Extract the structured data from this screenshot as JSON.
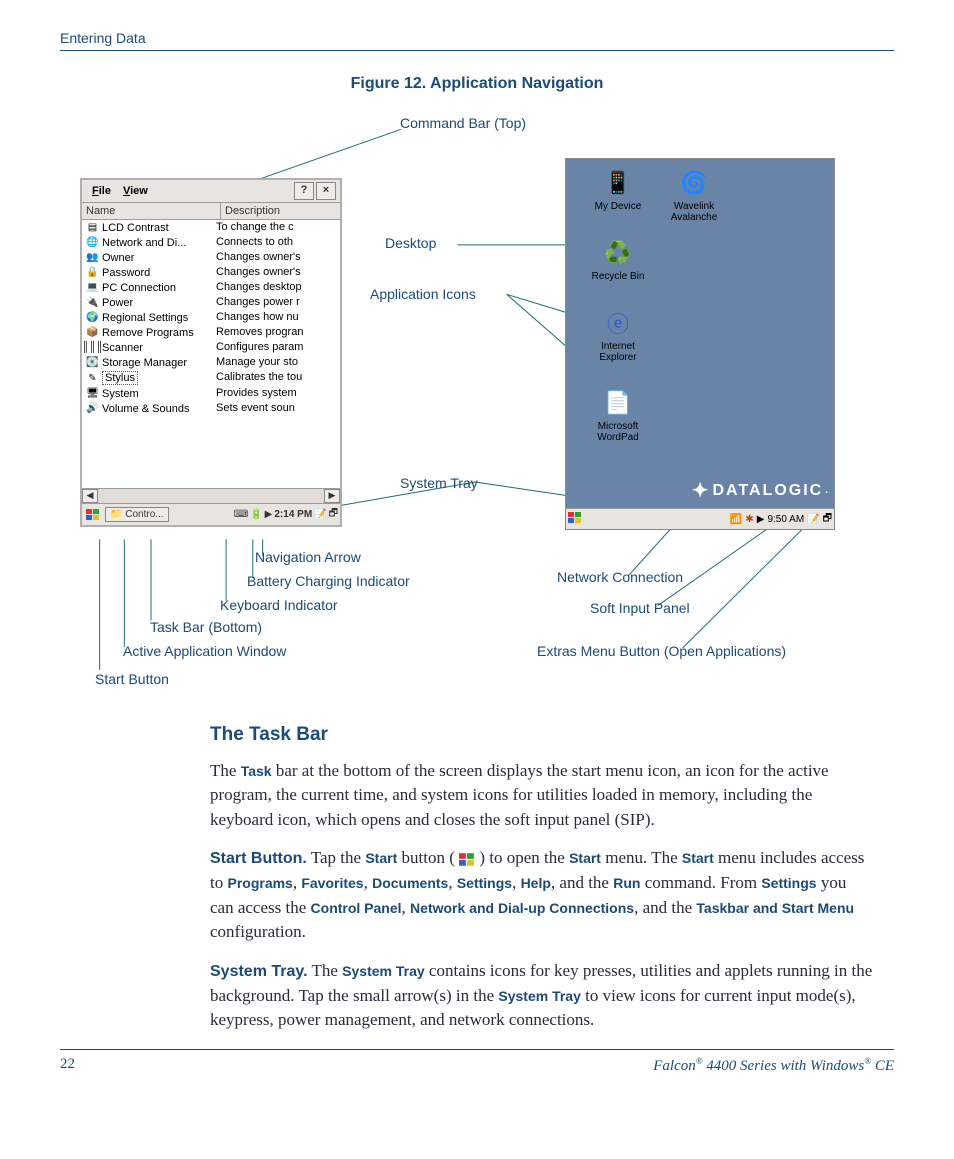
{
  "header": {
    "section": "Entering Data"
  },
  "figure": {
    "caption": "Figure 12. Application Navigation",
    "callouts": {
      "command_bar": "Command Bar (Top)",
      "desktop": "Desktop",
      "app_icons": "Application Icons",
      "system_tray": "System Tray",
      "nav_arrow": "Navigation Arrow",
      "battery": "Battery Charging Indicator",
      "keyboard": "Keyboard Indicator",
      "taskbar_bottom": "Task Bar (Bottom)",
      "active_app": "Active Application Window",
      "start_button": "Start Button",
      "network": "Network Connection",
      "sip": "Soft Input Panel",
      "extras": "Extras Menu Button (Open Applications)"
    }
  },
  "left_window": {
    "menu": {
      "file": "File",
      "view": "View"
    },
    "help_btn": "?",
    "close_btn": "×",
    "columns": {
      "name": "Name",
      "desc": "Description"
    },
    "rows": [
      {
        "name": "LCD Contrast",
        "desc": "To change the c"
      },
      {
        "name": "Network and Di...",
        "desc": "Connects to oth"
      },
      {
        "name": "Owner",
        "desc": "Changes owner's"
      },
      {
        "name": "Password",
        "desc": "Changes owner's"
      },
      {
        "name": "PC Connection",
        "desc": "Changes desktop"
      },
      {
        "name": "Power",
        "desc": "Changes power r"
      },
      {
        "name": "Regional Settings",
        "desc": "Changes how nu"
      },
      {
        "name": "Remove Programs",
        "desc": "Removes progran"
      },
      {
        "name": "Scanner",
        "desc": "Configures param"
      },
      {
        "name": "Storage Manager",
        "desc": "Manage your sto"
      },
      {
        "name": "Stylus",
        "desc": "Calibrates the tou"
      },
      {
        "name": "System",
        "desc": "Provides system"
      },
      {
        "name": "Volume & Sounds",
        "desc": "Sets event soun"
      }
    ],
    "taskbar": {
      "active": "Contro...",
      "time": "2:14 PM",
      "arrow": "▶"
    }
  },
  "right_desktop": {
    "icons": {
      "my_device": "My Device",
      "wavelink": "Wavelink Avalanche",
      "recycle": "Recycle Bin",
      "ie": "Internet Explorer",
      "wordpad": "Microsoft WordPad"
    },
    "brand": "DATALOGIC",
    "taskbar": {
      "time": "9:50 AM",
      "arrow": "▶"
    }
  },
  "body": {
    "h_taskbar": "The Task Bar",
    "p1_a": "The ",
    "p1_kw1": "Task",
    "p1_b": " bar at the bottom of the screen displays the start menu icon, an icon for the active program, the current time, and system icons for utilities loaded in memory, including the keyboard icon, which opens and closes the soft input panel (SIP).",
    "p2_lead": "Start Button.",
    "p2_a": " Tap the ",
    "p2_kw1": "Start",
    "p2_b": " button ( ",
    "p2_c": " ) to open the ",
    "p2_kw2": "Start",
    "p2_d": " menu. The ",
    "p2_kw3": "Start",
    "p2_e": " menu includes access to ",
    "p2_kw4": "Programs",
    "p2_f": ", ",
    "p2_kw5": "Favorites",
    "p2_g": ", ",
    "p2_kw6": "Documents",
    "p2_h": ", ",
    "p2_kw7": "Settings",
    "p2_i": ", ",
    "p2_kw8": "Help",
    "p2_j": ", and the ",
    "p2_kw9": "Run",
    "p2_k": " command. From ",
    "p2_kw10": "Settings",
    "p2_l": " you can access the ",
    "p2_kw11": "Control Panel",
    "p2_m": ", ",
    "p2_kw12": "Network and Dial-up Connections",
    "p2_n": ", and the ",
    "p2_kw13": "Taskbar and Start Menu",
    "p2_o": " configuration.",
    "p3_lead": "System Tray.",
    "p3_a": " The ",
    "p3_kw1": "System Tray",
    "p3_b": " contains icons for key presses, utilities and applets running in the background. Tap the small arrow(s) in the ",
    "p3_kw2": "System Tray",
    "p3_c": " to view icons for current input mode(s), keypress, power management, and network connections."
  },
  "footer": {
    "page": "22",
    "product_a": "Falcon",
    "product_b": " 4400 Series with Windows",
    "product_c": " CE",
    "reg": "®"
  }
}
